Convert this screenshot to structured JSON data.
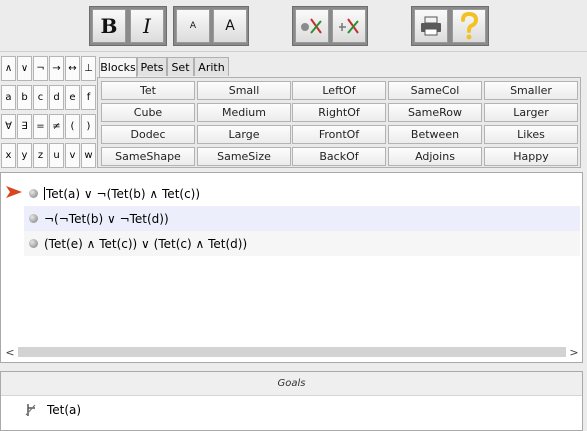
{
  "toolbar": {
    "bold_label": "B",
    "italic_label": "I",
    "font_smaller_label": "A",
    "font_larger_label": "A"
  },
  "keypad": {
    "rows": [
      [
        "∧",
        "∨",
        "¬",
        "→",
        "↔",
        "⊥"
      ],
      [
        "a",
        "b",
        "c",
        "d",
        "e",
        "f"
      ],
      [
        "∀",
        "∃",
        "=",
        "≠",
        "(",
        ")"
      ],
      [
        "x",
        "y",
        "z",
        "u",
        "v",
        "w"
      ]
    ]
  },
  "tabs": [
    {
      "label": "Blocks",
      "active": true
    },
    {
      "label": "Pets",
      "active": false
    },
    {
      "label": "Set",
      "active": false
    },
    {
      "label": "Arith",
      "active": false
    }
  ],
  "predicates": [
    [
      "Tet",
      "Small",
      "LeftOf",
      "SameCol",
      "Smaller"
    ],
    [
      "Cube",
      "Medium",
      "RightOf",
      "SameRow",
      "Larger"
    ],
    [
      "Dodec",
      "Large",
      "FrontOf",
      "Between",
      "Likes"
    ],
    [
      "SameShape",
      "SameSize",
      "BackOf",
      "Adjoins",
      "Happy"
    ]
  ],
  "sentences": [
    {
      "text": "Tet(a) ∨ ¬(Tet(b) ∧ Tet(c))",
      "current": true
    },
    {
      "text": "¬(¬Tet(b) ∨ ¬Tet(d))",
      "current": false
    },
    {
      "text": "(Tet(e) ∧ Tet(c)) ∨ (Tet(c) ∧ Tet(d))",
      "current": false
    }
  ],
  "scroll": {
    "left_arrow": "<",
    "right_arrow": ">"
  },
  "goals": {
    "header": "Goals",
    "items": [
      "Tet(a)"
    ]
  },
  "colors": {
    "pointer": "#d9451d",
    "highlight_row": "#eceefb",
    "help_icon": "#f2c224"
  }
}
